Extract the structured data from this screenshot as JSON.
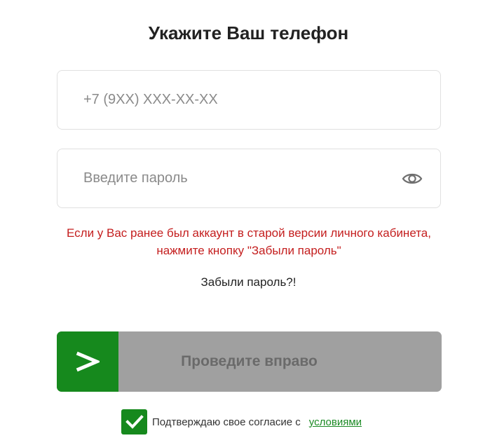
{
  "header": {
    "title": "Укажите Ваш телефон"
  },
  "phone": {
    "value": "",
    "placeholder": "+7 (9XX) XXX-XX-XX"
  },
  "password": {
    "value": "",
    "placeholder": "Введите пароль",
    "toggle_icon": "eye-icon"
  },
  "notice": {
    "text": "Если у Вас ранее был аккаунт в старой версии личного кабинета, нажмите кнопку \"Забыли пароль\""
  },
  "forgot": {
    "label": "Забыли пароль?!"
  },
  "slider": {
    "handle_glyph": ">",
    "label": "Проведите вправо",
    "progress": 0
  },
  "consent": {
    "checked": true,
    "text": "Подтверждаю свое согласие с",
    "link_label": "условиями"
  },
  "colors": {
    "accent_green": "#16891d",
    "notice_red": "#c41e1e",
    "slider_track": "#a0a0a0",
    "link_green": "#1b8a24"
  }
}
